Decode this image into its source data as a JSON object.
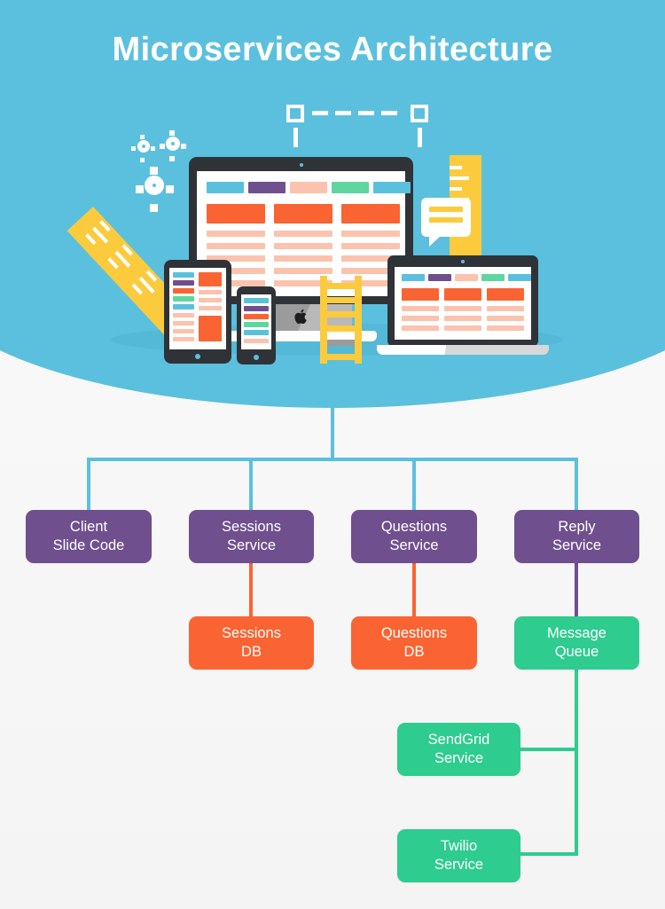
{
  "header": {
    "title": "Microservices Architecture",
    "background_color": "#5bc0de",
    "title_color": "#ffffff"
  },
  "illustration": {
    "name": "responsive-devices-illustration",
    "devices": [
      "desktop-monitor",
      "tablet",
      "smartphone",
      "laptop"
    ],
    "decorations": [
      "gears",
      "ruler",
      "chat-bubble",
      "ladder",
      "dashed-connector"
    ],
    "accent_colors": {
      "yellow": "#fccb3d",
      "orange": "#fa6432",
      "purple": "#6f4f8e",
      "green": "#2ecc8f",
      "blue": "#5bc0de",
      "dark": "#2f3337"
    }
  },
  "diagram": {
    "type": "tree",
    "root_label": "",
    "colors": {
      "service": "#6f4f8e",
      "database": "#fa6432",
      "queue_and_external": "#2ecc8f",
      "connector_primary": "#5bc0de",
      "connector_db": "#fa6432",
      "connector_queue": "#6f4f8e",
      "connector_external": "#2ecc8f"
    },
    "nodes": [
      {
        "id": "client",
        "line1": "Client",
        "line2": "Slide Code",
        "kind": "service"
      },
      {
        "id": "sessions_svc",
        "line1": "Sessions",
        "line2": "Service",
        "kind": "service"
      },
      {
        "id": "questions_svc",
        "line1": "Questions",
        "line2": "Service",
        "kind": "service"
      },
      {
        "id": "reply_svc",
        "line1": "Reply",
        "line2": "Service",
        "kind": "service"
      },
      {
        "id": "sessions_db",
        "line1": "Sessions",
        "line2": "DB",
        "kind": "database"
      },
      {
        "id": "questions_db",
        "line1": "Questions",
        "line2": "DB",
        "kind": "database"
      },
      {
        "id": "message_queue",
        "line1": "Message",
        "line2": "Queue",
        "kind": "queue"
      },
      {
        "id": "sendgrid",
        "line1": "SendGrid",
        "line2": "Service",
        "kind": "external"
      },
      {
        "id": "twilio",
        "line1": "Twilio",
        "line2": "Service",
        "kind": "external"
      }
    ],
    "edges": [
      {
        "from": "root",
        "to": "client"
      },
      {
        "from": "root",
        "to": "sessions_svc"
      },
      {
        "from": "root",
        "to": "questions_svc"
      },
      {
        "from": "root",
        "to": "reply_svc"
      },
      {
        "from": "sessions_svc",
        "to": "sessions_db"
      },
      {
        "from": "questions_svc",
        "to": "questions_db"
      },
      {
        "from": "reply_svc",
        "to": "message_queue"
      },
      {
        "from": "message_queue",
        "to": "sendgrid"
      },
      {
        "from": "message_queue",
        "to": "twilio"
      }
    ]
  }
}
